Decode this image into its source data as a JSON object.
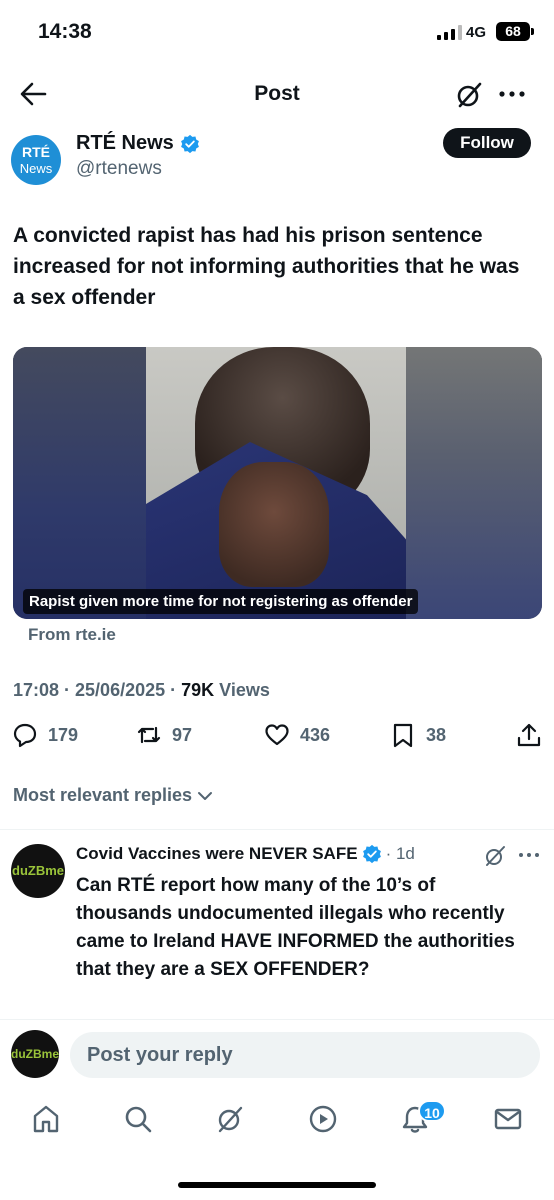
{
  "status_bar": {
    "time": "14:38",
    "network": "4G",
    "battery": "68"
  },
  "header": {
    "title": "Post"
  },
  "author": {
    "name": "RTÉ News",
    "handle": "@rtenews",
    "avatar_l1": "RTÉ",
    "avatar_l2": "News",
    "follow_label": "Follow"
  },
  "post": {
    "text": "A convicted rapist has had his prison sentence increased for not informing authorities that he was a sex offender",
    "card_caption": "Rapist given more time for not registering as offender",
    "card_source": "From rte.ie",
    "timestamp": "17:08 · 25/06/2025 · ",
    "views_count": "79K",
    "views_label": " Views"
  },
  "actions": {
    "replies": "179",
    "reposts": "97",
    "likes": "436",
    "bookmarks": "38"
  },
  "replies_filter": "Most relevant replies",
  "reply": {
    "name": "Covid Vaccines were NEVER SAFE",
    "time": "· 1d",
    "avatar_text": "duZBme",
    "text": "Can RTÉ report how many of the 10’s of thousands undocumented illegals who recently came to Ireland HAVE INFORMED the authorities that they are a SEX OFFENDER?"
  },
  "compose": {
    "placeholder": "Post your reply"
  },
  "nav": {
    "notifications_badge": "10"
  },
  "colors": {
    "verified": "#1d9bf0",
    "text": "#0f1419",
    "secondary": "#536471",
    "accent": "#1d9bf0"
  }
}
